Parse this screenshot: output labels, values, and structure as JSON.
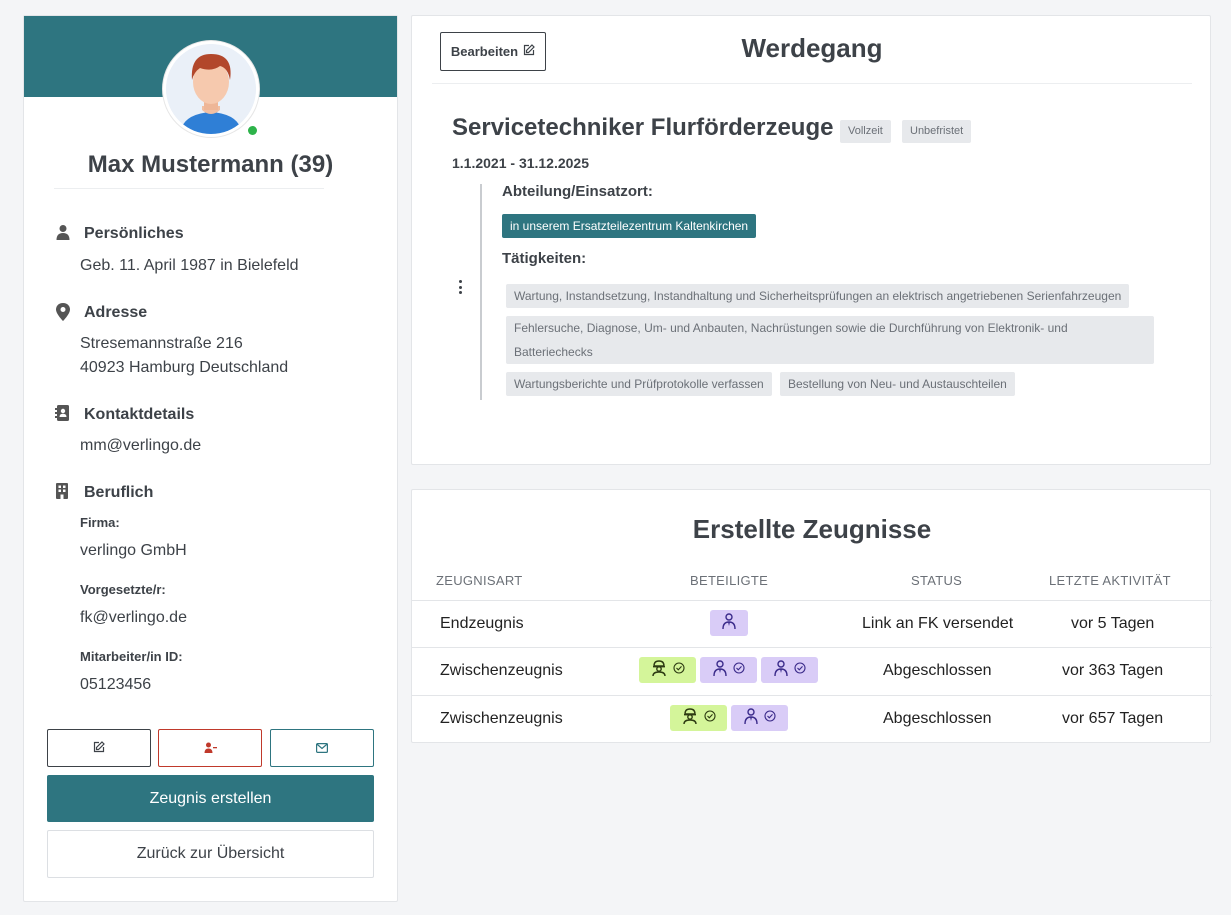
{
  "profile": {
    "name": "Max Mustermann (39)",
    "personal": {
      "title": "Persönliches",
      "birth": "Geb. 11. April 1987 in Bielefeld"
    },
    "address": {
      "title": "Adresse",
      "street": "Stresemannstraße 216",
      "city": "40923 Hamburg Deutschland"
    },
    "contact": {
      "title": "Kontaktdetails",
      "email": "mm@verlingo.de"
    },
    "work": {
      "title": "Beruflich",
      "company_label": "Firma:",
      "company": "verlingo GmbH",
      "supervisor_label": "Vorgesetzte/r:",
      "supervisor": "fk@verlingo.de",
      "employee_id_label": "Mitarbeiter/in ID:",
      "employee_id": "05123456"
    },
    "status_color": "#2db34a"
  },
  "actions": {
    "create_certificate": "Zeugnis erstellen",
    "back_to_overview": "Zurück zur Übersicht"
  },
  "career": {
    "edit_label": "Bearbeiten",
    "title": "Werdegang",
    "job_title": "Servicetechniker Flurförderzeuge",
    "tags": [
      "Vollzeit",
      "Unbefristet"
    ],
    "dates": "1.1.2021 - 31.12.2025",
    "department_label": "Abteilung/Einsatzort:",
    "department": "in unserem Ersatzteilezentrum Kaltenkirchen",
    "tasks_label": "Tätigkeiten:",
    "tasks": [
      "Wartung, Instandsetzung, Instandhaltung und Sicherheitsprüfungen an elektrisch angetriebenen Serienfahrzeugen",
      "Fehlersuche, Diagnose, Um- und Anbauten, Nachrüstungen sowie die Durchführung von Elektronik- und",
      "Batteriechecks",
      "Wartungsberichte und Prüfprotokolle verfassen",
      "Bestellung von Neu- und Austauschteilen"
    ]
  },
  "certificates": {
    "title": "Erstellte Zeugnisse",
    "columns": [
      "ZEUGNISART",
      "BETEILIGTE",
      "STATUS",
      "LETZTE AKTIVITÄT"
    ],
    "rows": [
      {
        "type": "Endzeugnis",
        "participants": [
          "supervisor"
        ],
        "status": "Link an FK versendet",
        "last_activity": "vor 5 Tagen"
      },
      {
        "type": "Zwischenzeugnis",
        "participants": [
          "worker-done",
          "supervisor-done",
          "supervisor-done"
        ],
        "status": "Abgeschlossen",
        "last_activity": "vor 363 Tagen"
      },
      {
        "type": "Zwischenzeugnis",
        "participants": [
          "worker-done",
          "supervisor-done"
        ],
        "status": "Abgeschlossen",
        "last_activity": "vor 657 Tagen"
      }
    ]
  },
  "colors": {
    "accent": "#2e7580",
    "danger": "#c0392b",
    "badge_purple": "#d9ccf7",
    "badge_green": "#d4f59a"
  }
}
